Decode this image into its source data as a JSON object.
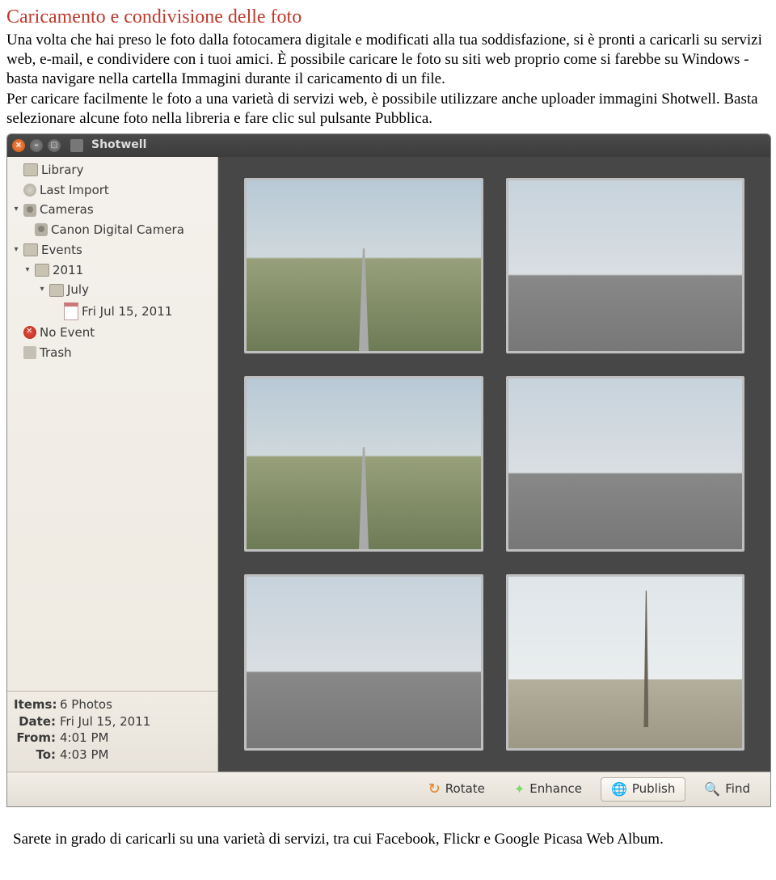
{
  "doc": {
    "heading": "Caricamento e condivisione delle foto",
    "para1": "Una volta che hai preso le foto dalla fotocamera digitale e modificati alla tua soddisfazione, si è pronti a caricarli su servizi web, e-mail, e condividere con i tuoi amici. È possibile caricare le foto su siti web proprio come si farebbe su Windows - basta navigare nella cartella Immagini durante il caricamento di un file.",
    "para2": "Per caricare facilmente le foto a una varietà di servizi web, è possibile utilizzare anche uploader immagini Shotwell. Basta selezionare alcune foto nella libreria e fare clic sul pulsante Pubblica.",
    "footer": "Sarete in grado di caricarli su una varietà di servizi, tra cui Facebook, Flickr e Google Picasa Web Album."
  },
  "shotwell": {
    "title": "Shotwell",
    "tree": {
      "library": "Library",
      "last_import": "Last Import",
      "cameras": "Cameras",
      "camera_model": "Canon Digital Camera",
      "events": "Events",
      "year": "2011",
      "month": "July",
      "date_label": "Fri Jul 15, 2011",
      "no_event": "No Event",
      "trash": "Trash"
    },
    "info": {
      "items_label": "Items:",
      "items_value": "6 Photos",
      "date_label": "Date:",
      "date_value": "Fri Jul 15, 2011",
      "from_label": "From:",
      "from_value": "4:01 PM",
      "to_label": "To:",
      "to_value": "4:03 PM"
    },
    "toolbar": {
      "rotate": "Rotate",
      "enhance": "Enhance",
      "publish": "Publish",
      "find": "Find"
    }
  }
}
